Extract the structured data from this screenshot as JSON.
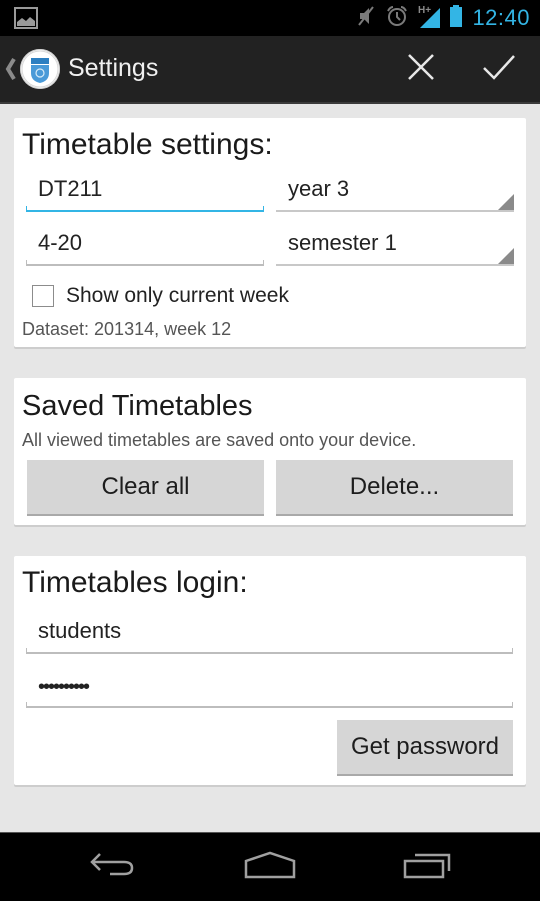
{
  "status_bar": {
    "time": "12:40",
    "icons": [
      "image-notification-icon",
      "mute-icon",
      "alarm-icon",
      "signal-hplus-icon",
      "battery-icon"
    ],
    "accent_color": "#33b5e5"
  },
  "action_bar": {
    "title": "Settings",
    "up_icon": "chevron-left-icon",
    "logo": "dit-logo",
    "cancel_icon": "close-icon",
    "done_icon": "check-icon"
  },
  "timetable_settings": {
    "title": "Timetable settings:",
    "course_code": "DT211",
    "year_select": "year 3",
    "weeks_range": "4-20",
    "semester_select": "semester 1",
    "show_current_week_label": "Show only current week",
    "show_current_week_checked": false,
    "dataset_info": "Dataset: 201314, week 12"
  },
  "saved_timetables": {
    "title": "Saved Timetables",
    "description": "All viewed timetables are saved onto your device.",
    "clear_all_label": "Clear all",
    "delete_label": "Delete..."
  },
  "login": {
    "title": "Timetables login:",
    "username": "students",
    "password_masked": "••••••••••",
    "get_password_label": "Get password"
  },
  "nav_bar": {
    "back_icon": "back-icon",
    "home_icon": "home-icon",
    "recents_icon": "recents-icon"
  }
}
